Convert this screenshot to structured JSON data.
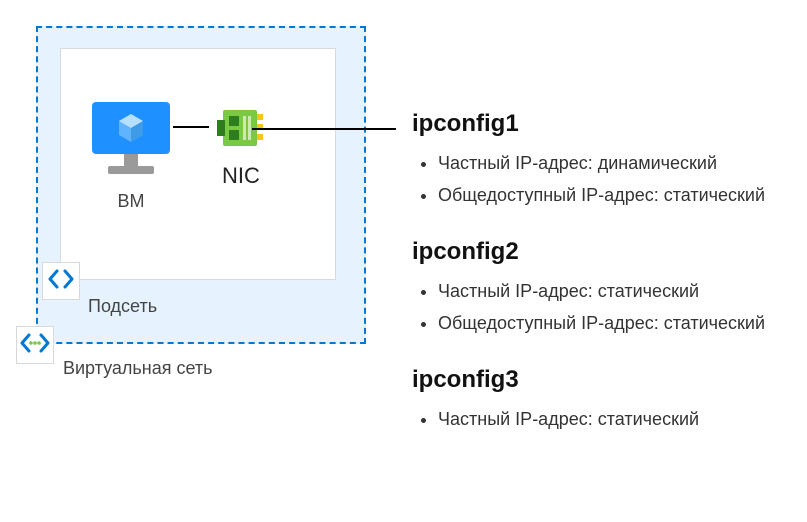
{
  "diagram": {
    "vnet_label": "Виртуальная сеть",
    "subnet_label": "Подсеть",
    "vm_label": "ВМ",
    "nic_label": "NIC",
    "icons": {
      "vnet": "vnet-icon",
      "subnet": "subnet-icon",
      "vm": "vm-icon",
      "nic": "nic-icon"
    },
    "colors": {
      "vnet_border": "#0078d4",
      "vnet_fill": "#e6f3ff",
      "vm_blue": "#1e90ff",
      "nic_green": "#7ac943",
      "nic_yellow": "#f5c518"
    }
  },
  "configs": [
    {
      "title": "ipconfig1",
      "items": [
        "Частный IP-адрес: динамический",
        "Общедоступный IP-адрес: статический"
      ]
    },
    {
      "title": "ipconfig2",
      "items": [
        "Частный IP-адрес: статический",
        "Общедоступный IP-адрес: статический"
      ]
    },
    {
      "title": "ipconfig3",
      "items": [
        "Частный IP-адрес: статический"
      ]
    }
  ]
}
